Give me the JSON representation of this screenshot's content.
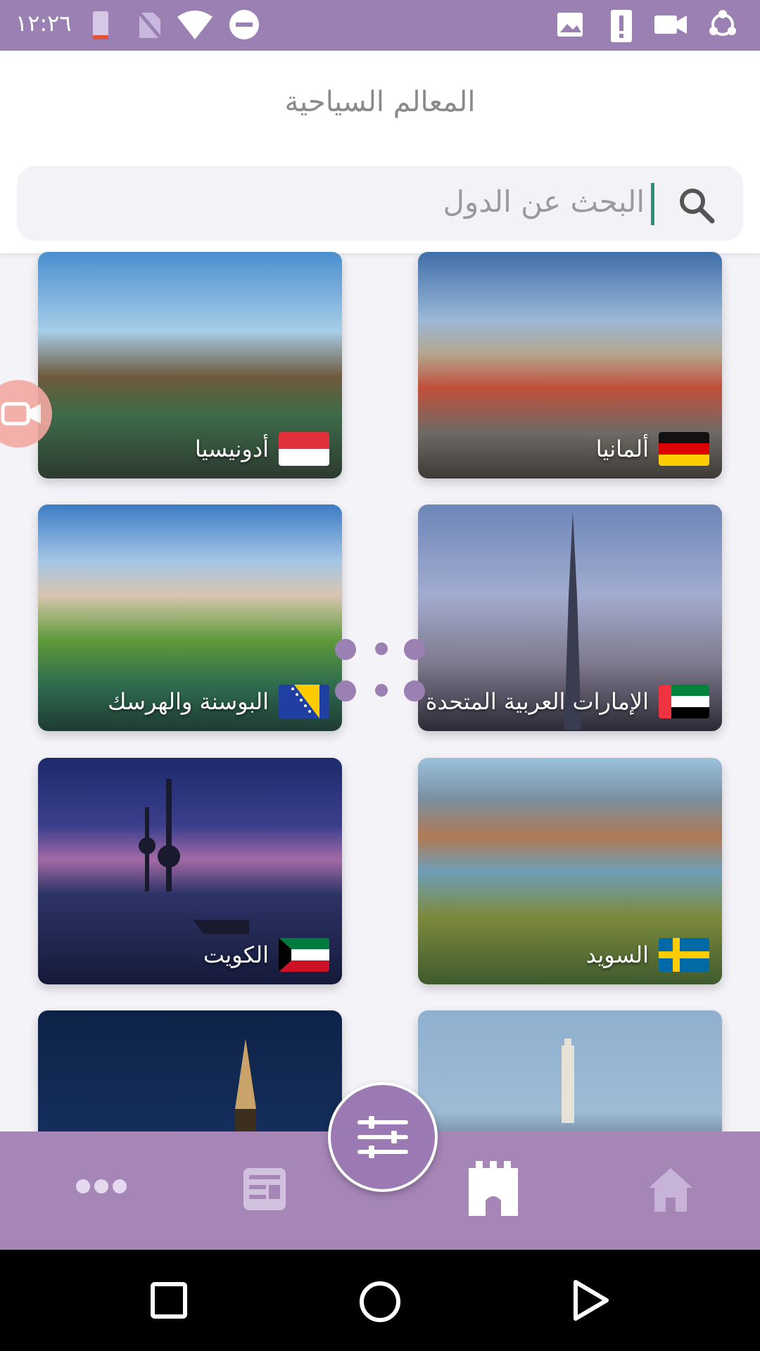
{
  "status_bar": {
    "time": "١٢:٢٦"
  },
  "header": {
    "title": "المعالم السياحية"
  },
  "search": {
    "placeholder": "البحث عن الدول"
  },
  "countries": [
    {
      "name": "ألمانيا"
    },
    {
      "name": "أدونيسيا"
    },
    {
      "name": "الإمارات العربية المتحدة"
    },
    {
      "name": "البوسنة والهرسك"
    },
    {
      "name": "السويد"
    },
    {
      "name": "الكويت"
    }
  ],
  "bottom_nav": {
    "items": [
      {
        "icon": "home-icon"
      },
      {
        "icon": "castle-icon",
        "active": true
      },
      {
        "icon": "filter-icon"
      },
      {
        "icon": "news-icon"
      },
      {
        "icon": "more-icon"
      }
    ]
  },
  "colors": {
    "accent": "#9b80b4",
    "nav_bg": "#a685b7"
  }
}
